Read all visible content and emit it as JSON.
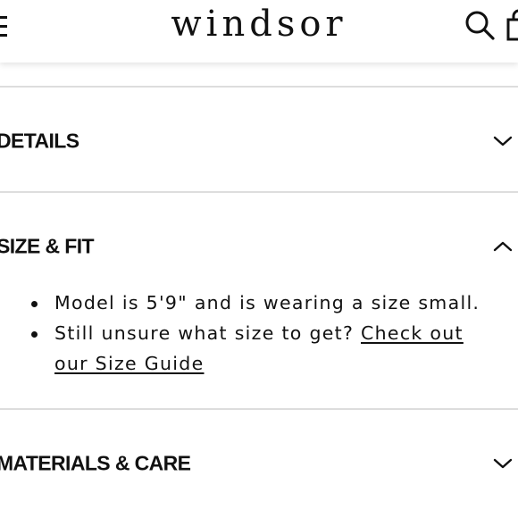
{
  "header": {
    "logo": "windsor",
    "menu_icon": "hamburger-menu-icon",
    "search_icon": "search-icon",
    "bag_icon": "shopping-bag-icon"
  },
  "accordion": {
    "sections": [
      {
        "title": "DETAILS",
        "expanded": false,
        "icon": "chevron-down-icon"
      },
      {
        "title": "SIZE & FIT",
        "expanded": true,
        "icon": "chevron-up-icon"
      },
      {
        "title": "MATERIALS & CARE",
        "expanded": false,
        "icon": "chevron-down-icon"
      }
    ],
    "size_fit": {
      "bullet_1": "Model is 5'9\" and is wearing a size small.",
      "bullet_2_text": "Still unsure what size to get? ",
      "bullet_2_link": "Check out our Size Guide"
    }
  },
  "colors": {
    "text": "#111111",
    "divider": "#dddddd",
    "background": "#ffffff"
  }
}
